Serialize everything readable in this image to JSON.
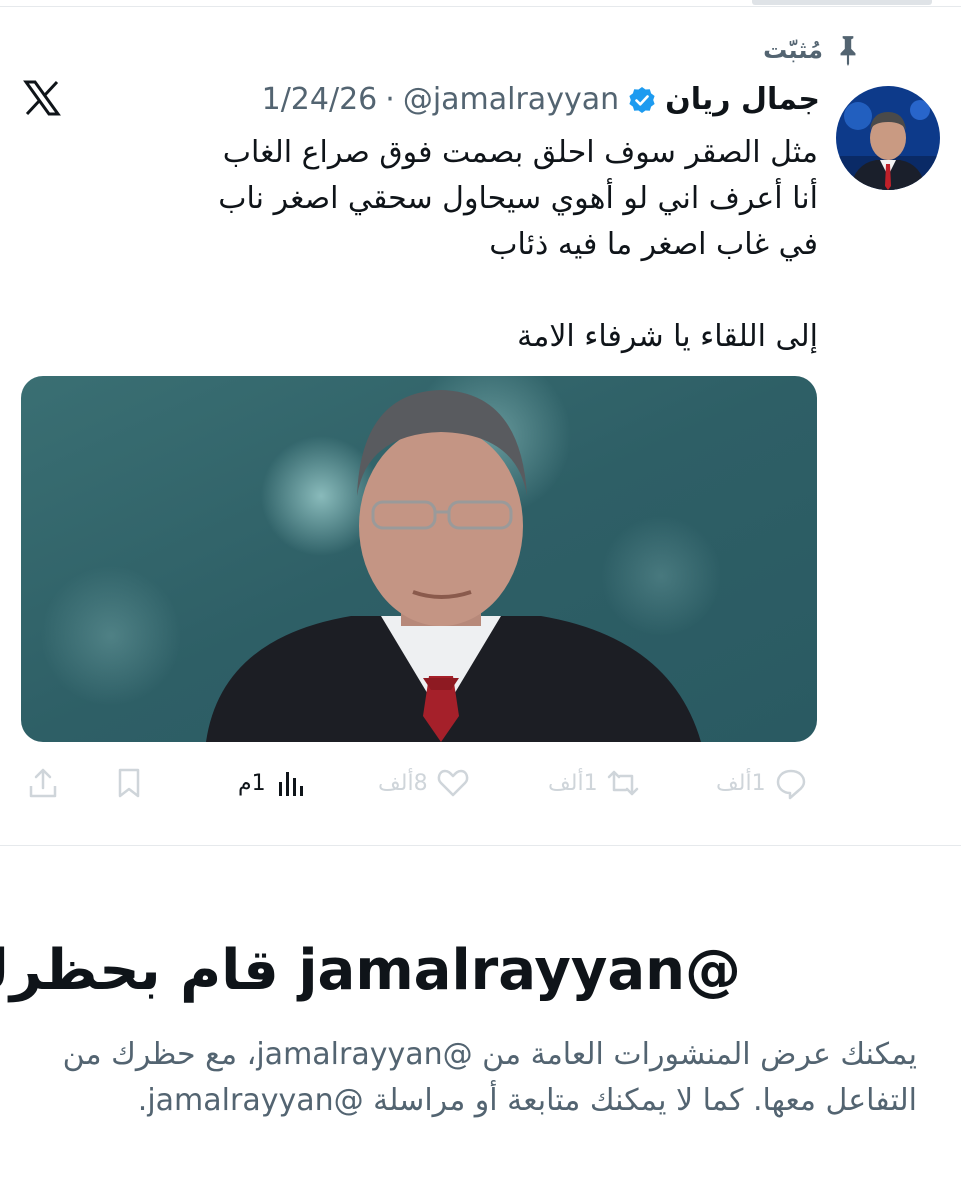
{
  "pinned": {
    "label": "مُثبّت",
    "icon": "pin-icon"
  },
  "tweet": {
    "display_name": "جمال ريان",
    "handle": "@jamalrayyan",
    "separator": "·",
    "date": "1/24/26",
    "lines": [
      "مثل الصقر سوف احلق بصمت فوق صراع الغاب",
      "أنا أعرف اني لو أهوي سيحاول سحقي اصغر ناب",
      "في غاب اصغر ما فيه ذئاب",
      "",
      "إلى اللقاء يا شرفاء الامة"
    ]
  },
  "actions": {
    "replies": "1ألف",
    "reposts": "1ألف",
    "likes": "8ألف",
    "views": "1م"
  },
  "blocked": {
    "title": "@jamalrayyan قام بحظرك",
    "description": "يمكنك عرض المنشورات العامة من @jamalrayyan، مع حظرك من التفاعل معها. كما لا يمكنك متابعة أو مراسلة @jamalrayyan."
  },
  "colors": {
    "verified": "#1d9bf0",
    "muted": "#536471",
    "action_disabled": "#cfd5da"
  }
}
